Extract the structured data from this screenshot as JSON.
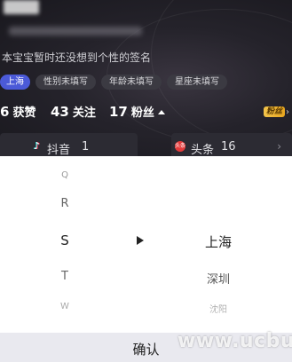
{
  "profile": {
    "bio": "本宝宝暂时还没想到个性的签名",
    "tags": [
      "上海",
      "性别未填写",
      "年龄未填写",
      "星座未填写"
    ],
    "stats": {
      "likes": {
        "count": "6",
        "label": "获赞"
      },
      "following": {
        "count": "43",
        "label": "关注"
      },
      "fans": {
        "count": "17",
        "label": "粉丝"
      }
    },
    "fans_badge": "粉丝",
    "platforms": {
      "douyin": {
        "name": "抖音",
        "count": "1"
      },
      "toutiao": {
        "name": "头条",
        "count": "16",
        "icon_text": "头条"
      }
    }
  },
  "picker": {
    "letters": [
      "Q",
      "R",
      "S",
      "T",
      "W"
    ],
    "selected_letter": "S",
    "cities": [
      "上海",
      "深圳",
      "沈阳"
    ],
    "selected_city": "上海"
  },
  "confirm_label": "确认",
  "watermark": "www.ucbug.cc",
  "colors": {
    "accent": "#4b5ad8",
    "dark_bg": "#1b1b22",
    "sheet_bg": "#ffffff",
    "confirm_bar": "#e9e9ef",
    "badge_gold": "#f3c54b"
  }
}
